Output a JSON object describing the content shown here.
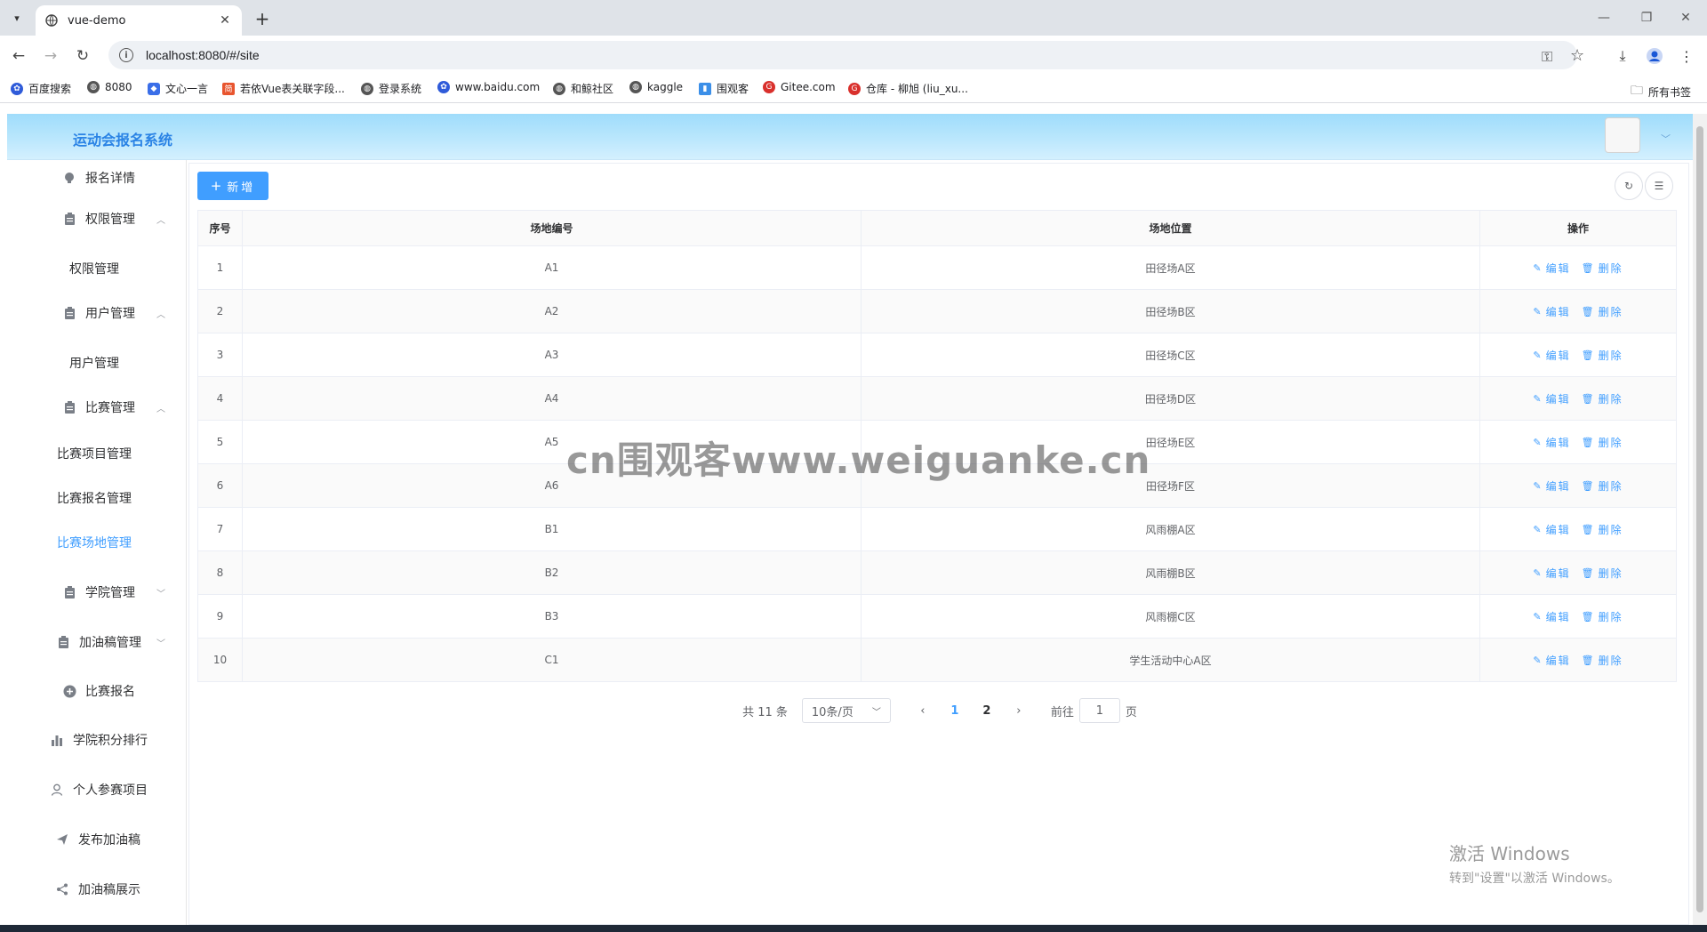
{
  "browser": {
    "tab_title": "vue-demo",
    "url": "localhost:8080/#/site",
    "bookmarks": [
      "百度搜索",
      "8080",
      "文心一言",
      "若依Vue表关联字段...",
      "登录系统",
      "www.baidu.com",
      "和鲸社区",
      "kaggle",
      "围观客",
      "Gitee.com",
      "仓库 - 柳旭 (liu_xu..."
    ],
    "all_bookmarks": "所有书签"
  },
  "app": {
    "title": "运动会报名系统"
  },
  "sidebar": {
    "items": [
      {
        "label": "报名详情",
        "icon": "bulb-icon"
      },
      {
        "label": "权限管理",
        "icon": "clipboard-icon",
        "caret": "^"
      },
      {
        "label": "权限管理"
      },
      {
        "label": "用户管理",
        "icon": "clipboard-icon",
        "caret": "^"
      },
      {
        "label": "用户管理"
      },
      {
        "label": "比赛管理",
        "icon": "clipboard-icon",
        "caret": "^"
      },
      {
        "label": "比赛项目管理"
      },
      {
        "label": "比赛报名管理"
      },
      {
        "label": "比赛场地管理",
        "active": true
      },
      {
        "label": "学院管理",
        "icon": "clipboard-icon",
        "caret": "v"
      },
      {
        "label": "加油稿管理",
        "icon": "clipboard-icon",
        "caret": "v"
      },
      {
        "label": "比赛报名",
        "icon": "plus-circle-icon"
      },
      {
        "label": "学院积分排行",
        "icon": "bar-chart-icon"
      },
      {
        "label": "个人参赛项目",
        "icon": "user-icon"
      },
      {
        "label": "发布加油稿",
        "icon": "send-icon"
      },
      {
        "label": "加油稿展示",
        "icon": "share-icon"
      }
    ],
    "active_color": "#409eff"
  },
  "toolbar": {
    "add_label": "新增"
  },
  "table": {
    "headers": [
      "序号",
      "场地编号",
      "场地位置",
      "操作"
    ],
    "rows": [
      [
        "1",
        "A1",
        "田径场A区"
      ],
      [
        "2",
        "A2",
        "田径场B区"
      ],
      [
        "3",
        "A3",
        "田径场C区"
      ],
      [
        "4",
        "A4",
        "田径场D区"
      ],
      [
        "5",
        "A5",
        "田径场E区"
      ],
      [
        "6",
        "A6",
        "田径场F区"
      ],
      [
        "7",
        "B1",
        "风雨棚A区"
      ],
      [
        "8",
        "B2",
        "风雨棚B区"
      ],
      [
        "9",
        "B3",
        "风雨棚C区"
      ],
      [
        "10",
        "C1",
        "学生活动中心A区"
      ]
    ],
    "edit_label": "编辑",
    "delete_label": "删除"
  },
  "pagination": {
    "total": "共 11 条",
    "page_size": "10条/页",
    "pages": [
      "1",
      "2"
    ],
    "current": "1",
    "goto_prefix": "前往",
    "goto_value": "1",
    "goto_suffix": "页"
  },
  "overlay": {
    "watermark": "cn围观客www.weiguanke.cn",
    "activate_title": "激活 Windows",
    "activate_sub": "转到\"设置\"以激活 Windows。"
  },
  "colors": {
    "primary": "#409eff",
    "title": "#2a83e5"
  }
}
